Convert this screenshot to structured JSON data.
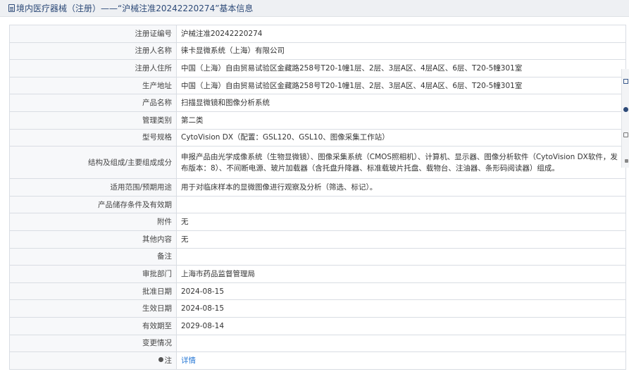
{
  "header": {
    "icon": "document-icon",
    "title": "境内医疗器械（注册）——“沪械注准20242220274”基本信息"
  },
  "rows": [
    {
      "label": "注册证编号",
      "value": "沪械注准20242220274"
    },
    {
      "label": "注册人名称",
      "value": "徕卡显微系统（上海）有限公司"
    },
    {
      "label": "注册人住所",
      "value": "中国（上海）自由贸易试验区金藏路258号T20-1幢1层、2层、3层A区、4层A区、6层、T20-5幢301室"
    },
    {
      "label": "生产地址",
      "value": "中国（上海）自由贸易试验区金藏路258号T20-1幢1层、2层、3层A区、4层A区、6层、T20-5幢301室"
    },
    {
      "label": "产品名称",
      "value": "扫描显微镜和图像分析系统"
    },
    {
      "label": "管理类别",
      "value": "第二类"
    },
    {
      "label": "型号规格",
      "value": "CytoVision DX（配置：GSL120、GSL10、图像采集工作站）"
    },
    {
      "label": "结构及组成/主要组成成分",
      "value": "申报产品由光学成像系统（生物显微镜）、图像采集系统（CMOS照相机）、计算机、显示器、图像分析软件（CytoVision DX软件，发布版本：8）、不间断电源、玻片加载器（含托盘升降器、标准载玻片托盘、载物台、注油器、条形码阅读器）组成。"
    },
    {
      "label": "适用范围/预期用途",
      "value": "用于对临床样本的显微图像进行观察及分析（筛选、标记）。"
    },
    {
      "label": "产品储存条件及有效期",
      "value": ""
    },
    {
      "label": "附件",
      "value": "无"
    },
    {
      "label": "其他内容",
      "value": "无"
    },
    {
      "label": "备注",
      "value": ""
    },
    {
      "label": "审批部门",
      "value": "上海市药品监督管理局"
    },
    {
      "label": "批准日期",
      "value": "2024-08-15"
    },
    {
      "label": "生效日期",
      "value": "2024-08-15"
    },
    {
      "label": "有效期至",
      "value": "2029-08-14"
    },
    {
      "label": "变更情况",
      "value": ""
    }
  ],
  "note_row": {
    "label": "注",
    "icon": "note-icon",
    "link": "详情"
  }
}
